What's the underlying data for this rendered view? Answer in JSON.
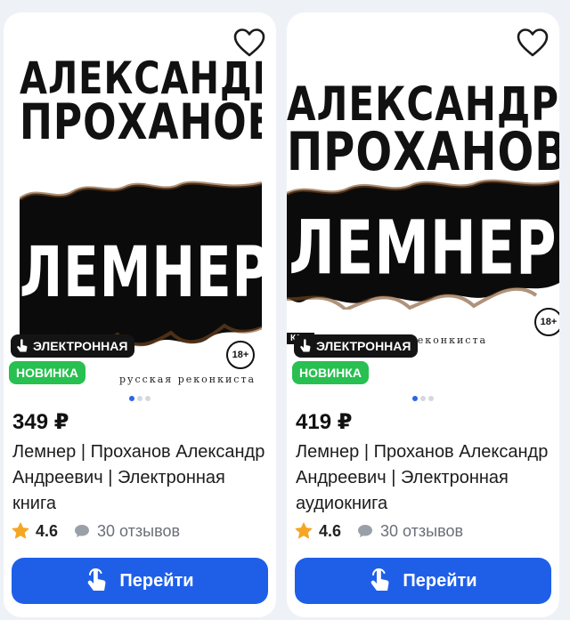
{
  "products": [
    {
      "cover": {
        "author_line1": "АЛЕКСАНДР",
        "author_line2": "ПРОХАНОВ",
        "title": "ЛЕМНЕР",
        "age_rating": "18+",
        "series": "русская реконкиста"
      },
      "badge_format": "ЭЛЕКТРОННАЯ",
      "badge_new": "НОВИНКА",
      "price": "349 ₽",
      "name": "Лемнер | Проханов Александр Андреевич | Электронная книга",
      "rating": "4.6",
      "reviews": "30 отзывов",
      "button_label": "Перейти",
      "favorite_icon": "heart-outline-icon"
    },
    {
      "cover": {
        "author_line1": "АЛЕКСАНДР",
        "author_line2": "ПРОХАНОВ",
        "title": "ЛЕМНЕР",
        "age_rating": "18+",
        "series": "русская реконкиста",
        "publisher_logo": "КПД"
      },
      "badge_format": "ЭЛЕКТРОННАЯ",
      "price": "419 ₽",
      "name": "Лемнер | Проханов Александр Андреевич | Электронная аудиокнига",
      "rating": "4.6",
      "reviews": "30 отзывов",
      "button_label": "Перейти",
      "favorite_icon": "heart-outline-icon"
    }
  ],
  "colors": {
    "accent_blue": "#1f5fe8",
    "badge_new_green": "#28c050",
    "badge_format_black": "#141414",
    "star_orange": "#f5a623"
  }
}
